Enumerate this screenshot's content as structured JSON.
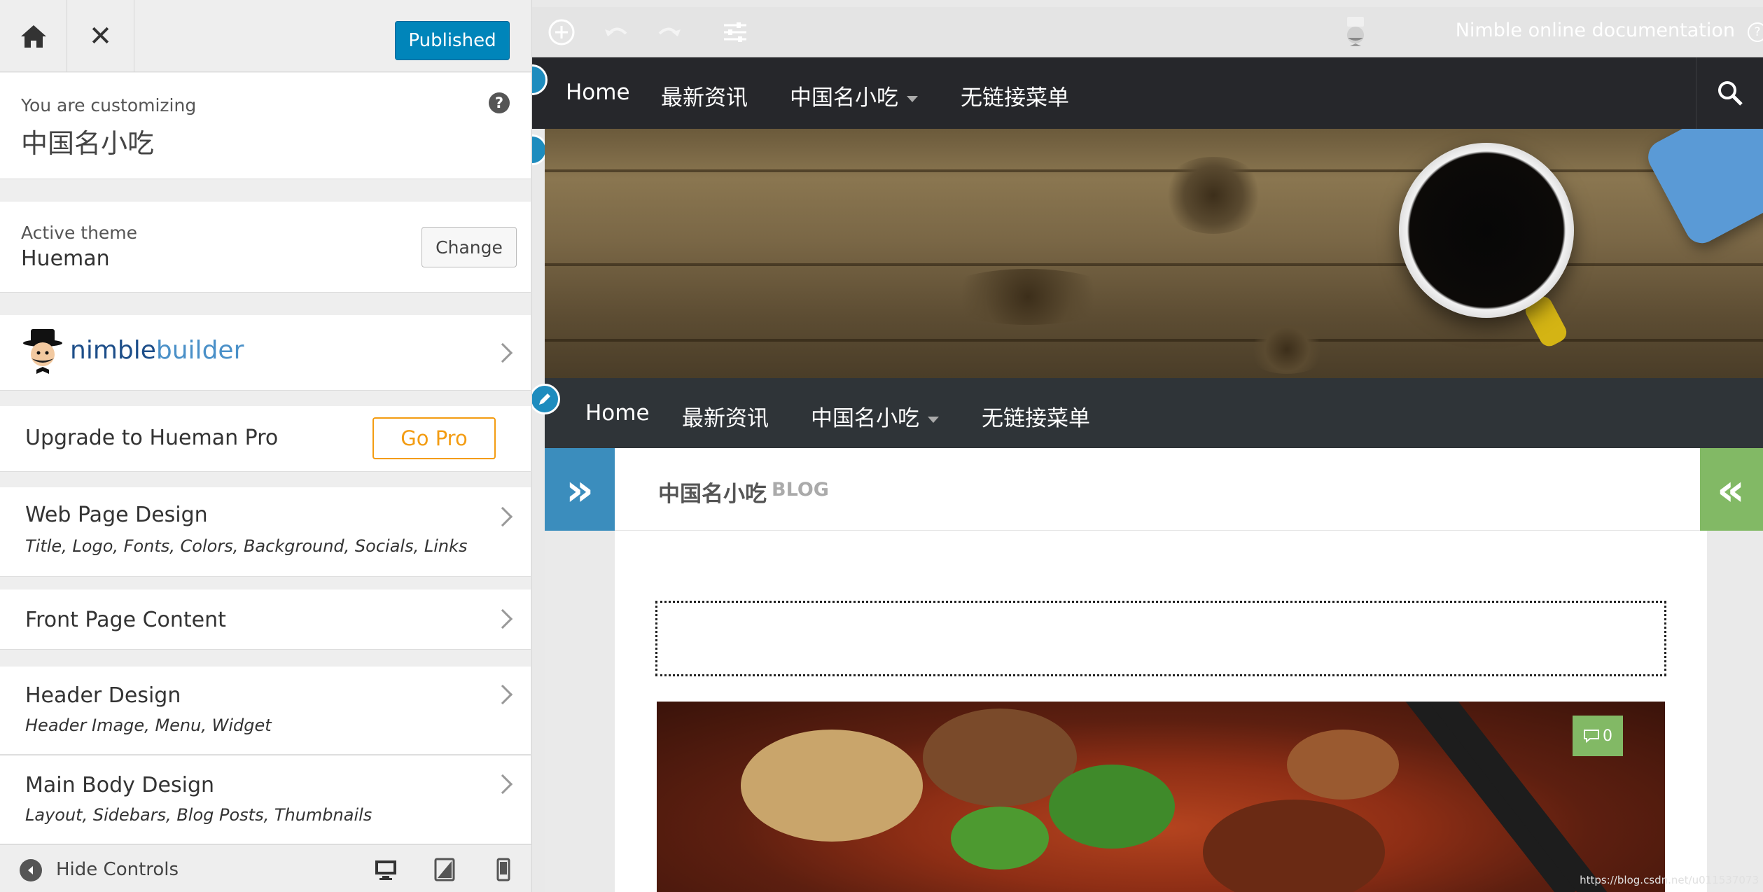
{
  "panel": {
    "published_label": "Published",
    "customizing_label": "You are customizing",
    "site_name": "中国名小吃",
    "active_theme_label": "Active theme",
    "theme_name": "Hueman",
    "change_label": "Change",
    "nimble_part1": "nimble",
    "nimble_part2": "builder",
    "upgrade_label": "Upgrade to Hueman Pro",
    "gopro_label": "Go Pro",
    "sections": [
      {
        "title": "Web Page Design",
        "sub": "Title, Logo, Fonts, Colors, Background, Socials, Links"
      },
      {
        "title": "Front Page Content",
        "sub": ""
      },
      {
        "title": "Header Design",
        "sub": "Header Image, Menu, Widget"
      },
      {
        "title": "Main Body Design",
        "sub": "Layout, Sidebars, Blog Posts, Thumbnails"
      }
    ],
    "hide_controls_label": "Hide Controls"
  },
  "preview": {
    "doc_label": "Nimble online documentation",
    "nav": [
      "Home",
      "最新资讯",
      "中国名小吃",
      "无链接菜单"
    ],
    "heading_title": "中国名小吃",
    "heading_badge": "BLOG",
    "comment_count": "0",
    "watermark": "https://blog.csdn.net/u011537073"
  },
  "colors": {
    "publish_blue": "#0085ba",
    "gopro_orange": "#f39c12",
    "nav_dark": "#26272b",
    "toggle_blue": "#3b8dbd",
    "toggle_green": "#82b965"
  }
}
